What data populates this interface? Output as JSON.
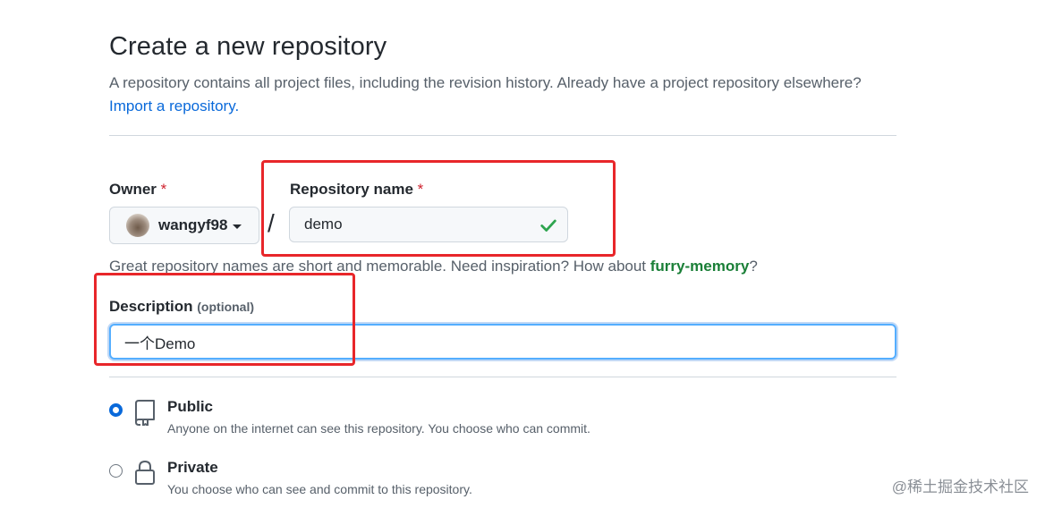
{
  "header": {
    "title": "Create a new repository",
    "subtitle": "A repository contains all project files, including the revision history. Already have a project repository elsewhere?",
    "import_link": "Import a repository."
  },
  "owner": {
    "label": "Owner",
    "required_mark": "*",
    "value": "wangyf98"
  },
  "separator": "/",
  "repo_name": {
    "label": "Repository name",
    "required_mark": "*",
    "value": "demo",
    "status_icon": "check-icon",
    "status_color": "#2da44e"
  },
  "name_hint": {
    "prefix": "Great repository names are short and memorable. Need inspiration? How about",
    "suggestion": "furry-memory",
    "suffix": "?"
  },
  "description": {
    "label": "Description",
    "optional": "(optional)",
    "value": "一个Demo"
  },
  "visibility": {
    "selected": "public",
    "options": [
      {
        "title": "Public",
        "description": "Anyone on the internet can see this repository. You choose who can commit.",
        "icon": "repo-icon"
      },
      {
        "title": "Private",
        "description": "You choose who can see and commit to this repository.",
        "icon": "lock-icon"
      }
    ]
  },
  "watermark": "@稀土掘金技术社区",
  "colors": {
    "accent": "#0969da",
    "highlight_box": "#e8262a",
    "success": "#1a7f37"
  }
}
